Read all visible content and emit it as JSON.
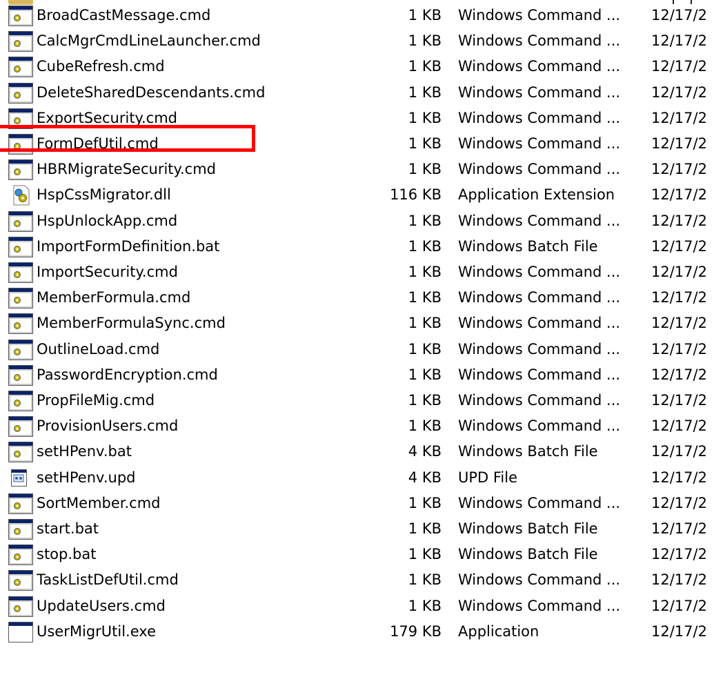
{
  "files": [
    {
      "name": "BroadCastMessage.cmd",
      "size": "1 KB",
      "type": "Windows Command ...",
      "date": "12/17/2",
      "icon": "cmd-icon"
    },
    {
      "name": "CalcMgrCmdLineLauncher.cmd",
      "size": "1 KB",
      "type": "Windows Command ...",
      "date": "12/17/2",
      "icon": "cmd-icon"
    },
    {
      "name": "CubeRefresh.cmd",
      "size": "1 KB",
      "type": "Windows Command ...",
      "date": "12/17/2",
      "icon": "cmd-icon"
    },
    {
      "name": "DeleteSharedDescendants.cmd",
      "size": "1 KB",
      "type": "Windows Command ...",
      "date": "12/17/2",
      "icon": "cmd-icon"
    },
    {
      "name": "ExportSecurity.cmd",
      "size": "1 KB",
      "type": "Windows Command ...",
      "date": "12/17/2",
      "icon": "cmd-icon"
    },
    {
      "name": "FormDefUtil.cmd",
      "size": "1 KB",
      "type": "Windows Command ...",
      "date": "12/17/2",
      "icon": "cmd-icon"
    },
    {
      "name": "HBRMigrateSecurity.cmd",
      "size": "1 KB",
      "type": "Windows Command ...",
      "date": "12/17/2",
      "icon": "cmd-icon"
    },
    {
      "name": "HspCssMigrator.dll",
      "size": "116 KB",
      "type": "Application Extension",
      "date": "12/17/2",
      "icon": "dll-icon"
    },
    {
      "name": "HspUnlockApp.cmd",
      "size": "1 KB",
      "type": "Windows Command ...",
      "date": "12/17/2",
      "icon": "cmd-icon"
    },
    {
      "name": "ImportFormDefinition.bat",
      "size": "1 KB",
      "type": "Windows Batch File",
      "date": "12/17/2",
      "icon": "cmd-icon"
    },
    {
      "name": "ImportSecurity.cmd",
      "size": "1 KB",
      "type": "Windows Command ...",
      "date": "12/17/2",
      "icon": "cmd-icon"
    },
    {
      "name": "MemberFormula.cmd",
      "size": "1 KB",
      "type": "Windows Command ...",
      "date": "12/17/2",
      "icon": "cmd-icon"
    },
    {
      "name": "MemberFormulaSync.cmd",
      "size": "1 KB",
      "type": "Windows Command ...",
      "date": "12/17/2",
      "icon": "cmd-icon"
    },
    {
      "name": "OutlineLoad.cmd",
      "size": "1 KB",
      "type": "Windows Command ...",
      "date": "12/17/2",
      "icon": "cmd-icon"
    },
    {
      "name": "PasswordEncryption.cmd",
      "size": "1 KB",
      "type": "Windows Command ...",
      "date": "12/17/2",
      "icon": "cmd-icon"
    },
    {
      "name": "PropFileMig.cmd",
      "size": "1 KB",
      "type": "Windows Command ...",
      "date": "12/17/2",
      "icon": "cmd-icon"
    },
    {
      "name": "ProvisionUsers.cmd",
      "size": "1 KB",
      "type": "Windows Command ...",
      "date": "12/17/2",
      "icon": "cmd-icon"
    },
    {
      "name": "setHPenv.bat",
      "size": "4 KB",
      "type": "Windows Batch File",
      "date": "12/17/2",
      "icon": "cmd-icon"
    },
    {
      "name": "setHPenv.upd",
      "size": "4 KB",
      "type": "UPD File",
      "date": "12/17/2",
      "icon": "upd-icon"
    },
    {
      "name": "SortMember.cmd",
      "size": "1 KB",
      "type": "Windows Command ...",
      "date": "12/17/2",
      "icon": "cmd-icon"
    },
    {
      "name": "start.bat",
      "size": "1 KB",
      "type": "Windows Batch File",
      "date": "12/17/2",
      "icon": "cmd-icon"
    },
    {
      "name": "stop.bat",
      "size": "1 KB",
      "type": "Windows Batch File",
      "date": "12/17/2",
      "icon": "cmd-icon"
    },
    {
      "name": "TaskListDefUtil.cmd",
      "size": "1 KB",
      "type": "Windows Command ...",
      "date": "12/17/2",
      "icon": "cmd-icon"
    },
    {
      "name": "UpdateUsers.cmd",
      "size": "1 KB",
      "type": "Windows Command ...",
      "date": "12/17/2",
      "icon": "cmd-icon"
    },
    {
      "name": "UserMigrUtil.exe",
      "size": "179 KB",
      "type": "Application",
      "date": "12/17/2",
      "icon": "exe-icon"
    }
  ],
  "colors": {
    "highlight": "#ff0000",
    "icon_titlebar": "#0a246a",
    "icon_gear": "#c9b400"
  }
}
